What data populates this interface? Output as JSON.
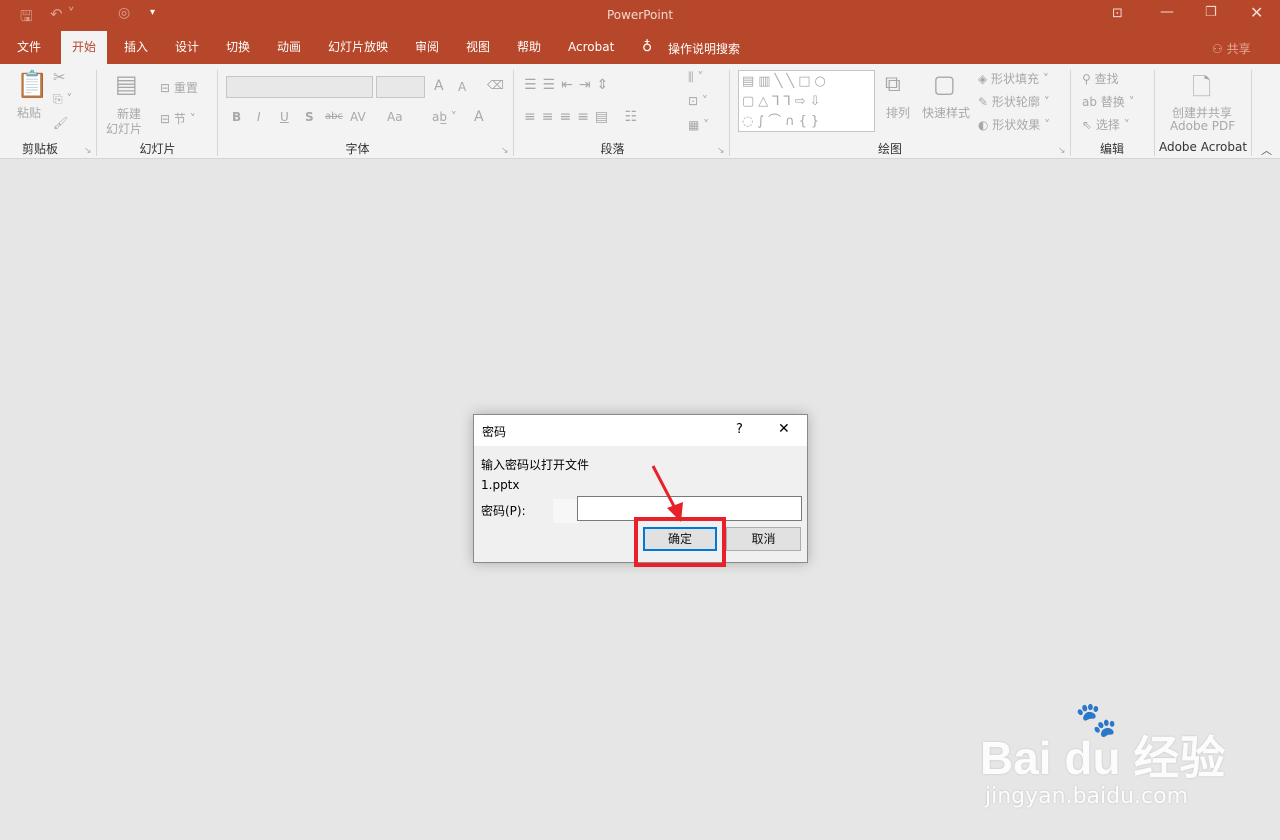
{
  "title_bar": {
    "app_title": "PowerPoint",
    "quick_access": [
      "save-icon",
      "undo-icon",
      "presentation-icon",
      "customize-icon"
    ],
    "window_controls": [
      "ribbon-display-icon",
      "minimize-icon",
      "restore-icon",
      "close-icon"
    ]
  },
  "tabs": [
    {
      "label": "文件"
    },
    {
      "label": "开始",
      "active": true
    },
    {
      "label": "插入"
    },
    {
      "label": "设计"
    },
    {
      "label": "切换"
    },
    {
      "label": "动画"
    },
    {
      "label": "幻灯片放映"
    },
    {
      "label": "审阅"
    },
    {
      "label": "视图"
    },
    {
      "label": "帮助"
    },
    {
      "label": "Acrobat"
    }
  ],
  "tell_me": "操作说明搜索",
  "share": "共享",
  "ribbon": {
    "clipboard": {
      "label": "剪贴板",
      "paste": "粘贴"
    },
    "slides": {
      "label": "幻灯片",
      "new_slide_1": "新建",
      "new_slide_2": "幻灯片",
      "reset": "重置",
      "section": "节"
    },
    "font": {
      "label": "字体",
      "bold": "B",
      "italic": "I",
      "underline": "U",
      "shadow": "S",
      "strike": "abc",
      "spacing": "AV",
      "case": "Aa",
      "color": "A",
      "grow": "A",
      "shrink": "A"
    },
    "paragraph": {
      "label": "段落"
    },
    "drawing": {
      "label": "绘图",
      "arrange": "排列",
      "quick_styles": "快速样式",
      "fill": "形状填充",
      "outline": "形状轮廓",
      "effects": "形状效果"
    },
    "editing": {
      "label": "编辑",
      "find": "查找",
      "replace": "替换",
      "select": "选择"
    },
    "acrobat": {
      "label": "Adobe Acrobat",
      "create_1": "创建并共享",
      "create_2": "Adobe PDF"
    }
  },
  "dialog": {
    "title": "密码",
    "help": "?",
    "close": "✕",
    "message": "输入密码以打开文件",
    "filename": "1.pptx",
    "password_label": "密码(P):",
    "password_value": "",
    "ok": "确定",
    "cancel": "取消"
  },
  "annotation_color": "#e8202a",
  "accent_color": "#b7472a",
  "watermark": {
    "brand": "Bai du 经验",
    "url": "jingyan.baidu.com"
  }
}
